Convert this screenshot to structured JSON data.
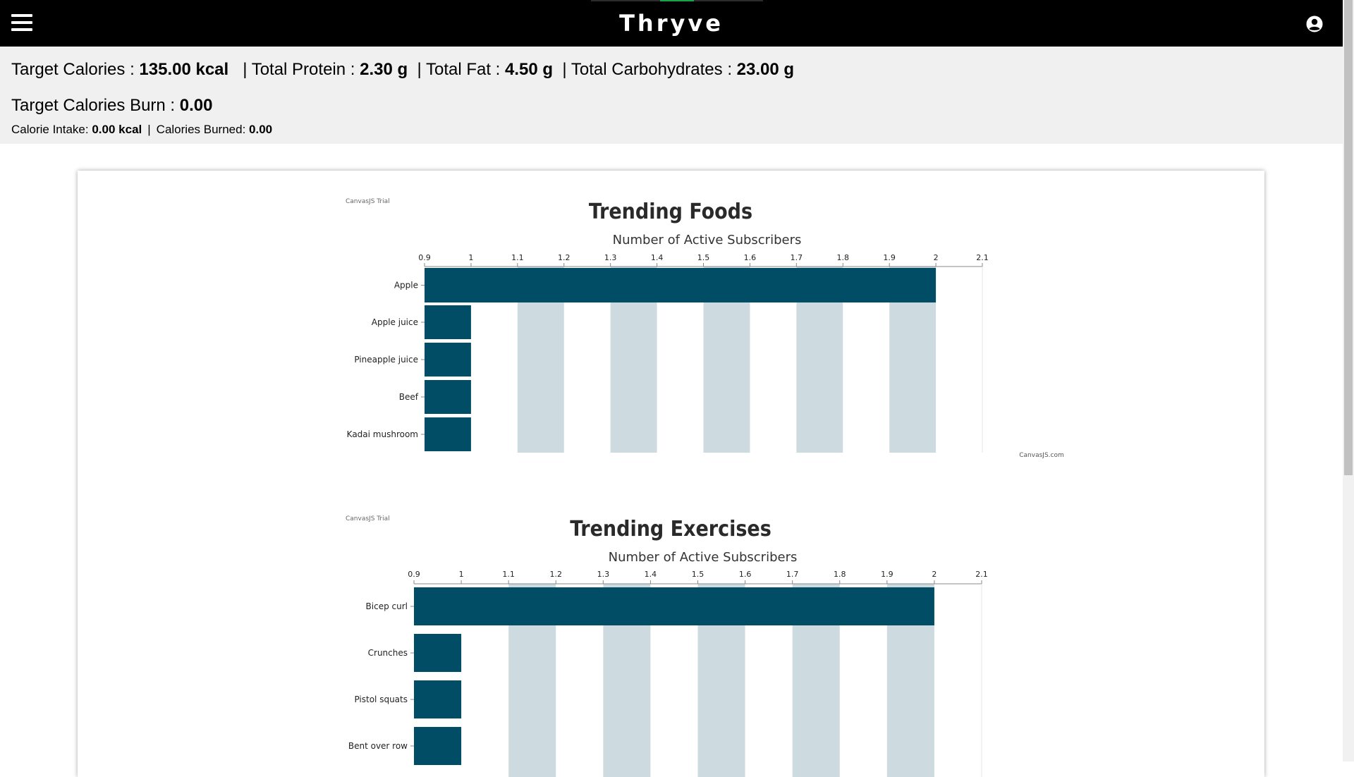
{
  "app": {
    "brand": "Thryve"
  },
  "header": {
    "menu_icon": "hamburger-menu-icon",
    "user_icon": "user-circle-icon"
  },
  "summary": {
    "target_calories_label": "Target Calories : ",
    "target_calories_value": "135.00 kcal",
    "protein_label": "| Total Protein : ",
    "protein_value": "2.30 g",
    "fat_label": "| Total Fat : ",
    "fat_value": "4.50 g",
    "carbs_label": "| Total Carbohydrates : ",
    "carbs_value": "23.00 g",
    "burn_label": "Target Calories Burn : ",
    "burn_value": "0.00",
    "intake_label": "Calorie Intake: ",
    "intake_value": "0.00 kcal",
    "divider": "|",
    "burned_label": "Calories Burned: ",
    "burned_value": "0.00"
  },
  "colors": {
    "bar": "#024d66",
    "stripe": "#cddbe0",
    "topbar": "#000000",
    "summary_bg": "#f0f0f0"
  },
  "chart_data": [
    {
      "type": "bar",
      "orientation": "horizontal",
      "title": "Trending Foods",
      "axis_title": "Number of Active Subscribers",
      "trial_label": "CanvasJS Trial",
      "credit": "CanvasJS.com",
      "categories": [
        "Apple",
        "Apple juice",
        "Pineapple juice",
        "Beef",
        "Kadai mushroom"
      ],
      "values": [
        2,
        1,
        1,
        1,
        1
      ],
      "ticks": [
        "0.9",
        "1",
        "1.1",
        "1.2",
        "1.3",
        "1.4",
        "1.5",
        "1.6",
        "1.7",
        "1.8",
        "1.9",
        "2",
        "2.1"
      ],
      "xlim": [
        0.9,
        2.1
      ],
      "interlaced_grid": true
    },
    {
      "type": "bar",
      "orientation": "horizontal",
      "title": "Trending Exercises",
      "axis_title": "Number of Active Subscribers",
      "trial_label": "CanvasJS Trial",
      "categories": [
        "Bicep curl",
        "Crunches",
        "Pistol squats",
        "Bent over row"
      ],
      "values": [
        2,
        1,
        1,
        1
      ],
      "ticks": [
        "0.9",
        "1",
        "1.1",
        "1.2",
        "1.3",
        "1.4",
        "1.5",
        "1.6",
        "1.7",
        "1.8",
        "1.9",
        "2",
        "2.1"
      ],
      "xlim": [
        0.9,
        2.1
      ],
      "interlaced_grid": true
    }
  ]
}
